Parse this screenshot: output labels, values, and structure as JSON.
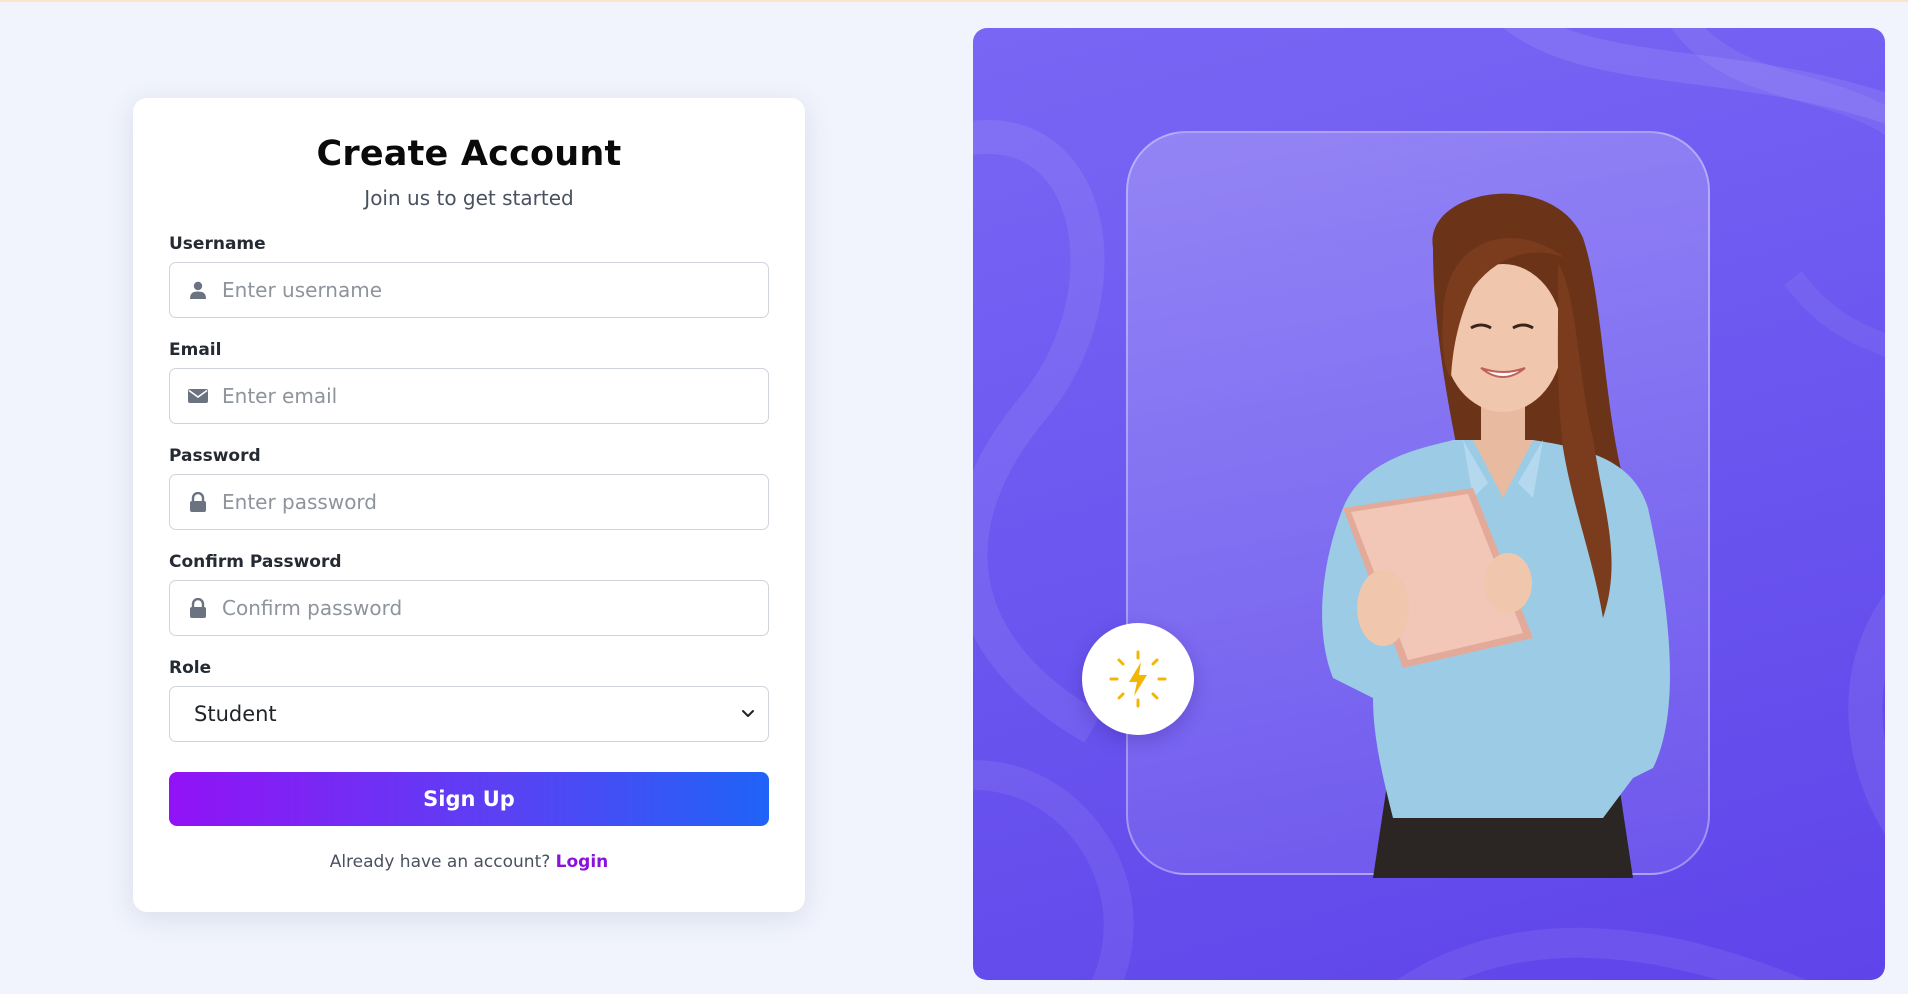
{
  "form": {
    "title": "Create Account",
    "subtitle": "Join us to get started",
    "username": {
      "label": "Username",
      "placeholder": "Enter username",
      "icon": "user-icon"
    },
    "email": {
      "label": "Email",
      "placeholder": "Enter email",
      "icon": "envelope-icon"
    },
    "password": {
      "label": "Password",
      "placeholder": "Enter password",
      "icon": "lock-icon"
    },
    "confirm_password": {
      "label": "Confirm Password",
      "placeholder": "Confirm password",
      "icon": "lock-icon"
    },
    "role": {
      "label": "Role",
      "selected": "Student",
      "icon": "chevron-down-icon"
    },
    "signup_button": "Sign Up",
    "footer_text": "Already have an account?",
    "login_link": "Login"
  },
  "colors": {
    "page_background": "#f1f4fd",
    "button_gradient_start": "#9212f6",
    "button_gradient_end": "#1f63f7",
    "login_link": "#8b12d8",
    "hero_background": "#6c58f0",
    "bolt": "#f2b705"
  },
  "hero": {
    "badge_icon": "lightning-bolt-icon",
    "illustration": "woman-with-tablet-illustration"
  }
}
